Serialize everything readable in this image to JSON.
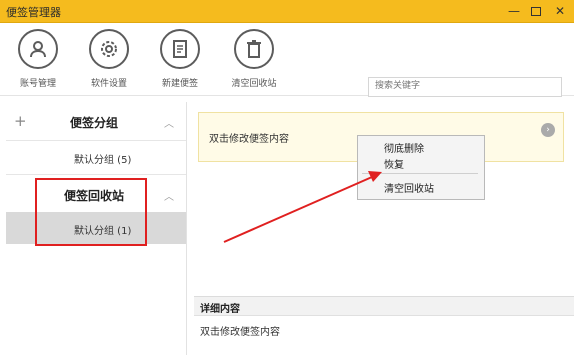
{
  "window": {
    "title": "便签管理器",
    "min_label": "—",
    "close_label": "✕"
  },
  "toolbar": {
    "items": [
      {
        "label": "账号管理",
        "icon": "user-icon"
      },
      {
        "label": "软件设置",
        "icon": "gear-icon"
      },
      {
        "label": "新建便签",
        "icon": "new-note-icon"
      },
      {
        "label": "清空回收站",
        "icon": "trash-icon"
      }
    ],
    "search_placeholder": "搜索关键字"
  },
  "sidebar": {
    "add_symbol": "+",
    "groups": [
      {
        "name": "便签分组",
        "items": [
          {
            "label": "默认分组 (5)"
          }
        ]
      },
      {
        "name": "便签回收站",
        "items": [
          {
            "label": "默认分组 (1)",
            "selected": true
          }
        ]
      }
    ],
    "chevron": "︿"
  },
  "notes": [
    {
      "text": "双击修改便签内容",
      "action_symbol": "›"
    }
  ],
  "context_menu": {
    "items": [
      "彻底删除",
      "恢复",
      "清空回收站"
    ]
  },
  "detail": {
    "title": "详细内容",
    "content": "双击修改便签内容"
  },
  "colors": {
    "titlebar": "#f5bb1e",
    "annotation_red": "#e02020",
    "note_bg": "#fffbe7"
  }
}
